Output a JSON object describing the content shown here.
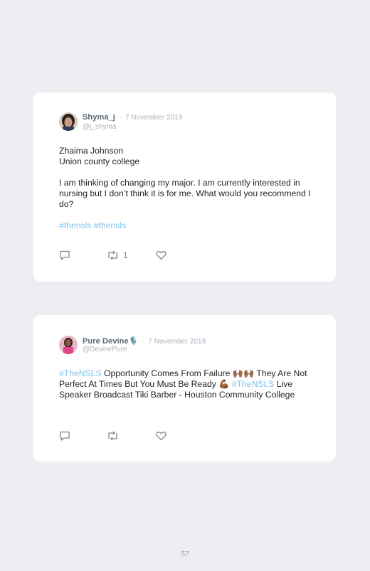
{
  "page_number": "57",
  "colors": {
    "background": "#eceef1",
    "card": "#ffffff",
    "hashtag": "#7ec3ea",
    "name": "#5a6672",
    "meta": "#a8b1ba"
  },
  "tweets": [
    {
      "display_name": "Shyma_j",
      "separator": "·",
      "date": "7 November 2019",
      "handle": "@j_shyma",
      "avatar_icon": "avatar-photo",
      "lines": [
        "Zhaima Johnson",
        "Union county college"
      ],
      "paragraph": "I am thinking of changing my major. I am currently interested in nursing but I don’t think it is for me. What would you recommend I do?",
      "hashtags": "#thensls #thensls",
      "reply_icon": "reply-icon",
      "retweet_icon": "retweet-icon",
      "retweet_count": "1",
      "like_icon": "like-icon"
    },
    {
      "display_name": "Pure Devine🎙️",
      "separator": "·",
      "date": "7 November 2019",
      "handle": "@DevinePure",
      "avatar_icon": "avatar-photo",
      "hashtag1": "#TheNSLS",
      "text1": " Opportunity Comes From Failure 🙌🏾🙌🏾 They Are Not Perfect At Times But You Must Be Ready 💪🏾 ",
      "hashtag2": "#TheNSLS",
      "text2": " Live Speaker Broadcast Tiki Barber - Houston Community College",
      "reply_icon": "reply-icon",
      "retweet_icon": "retweet-icon",
      "like_icon": "like-icon"
    }
  ]
}
